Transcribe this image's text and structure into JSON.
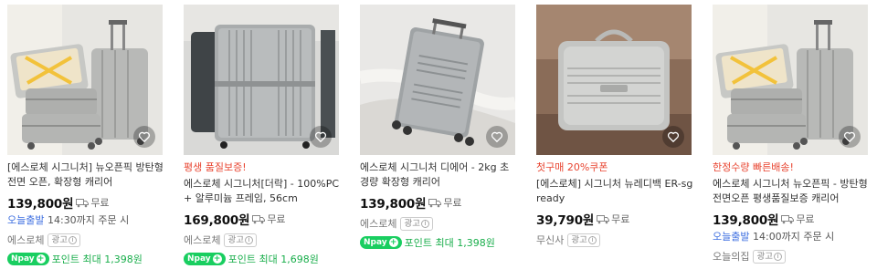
{
  "products": [
    {
      "promo": "",
      "title": "[에스로체 시그니처] 뉴오픈픽 방탄형 전면 오픈, 확장형 캐리어",
      "price": "139,800원",
      "shipping": "무료",
      "delivery_highlight": "오늘출발",
      "delivery_rest": "14:30까지 주문 시",
      "seller": "에스로체",
      "ad_label": "광고",
      "points": "포인트 최대 1,398원",
      "npay_label": "pay",
      "icons": [
        "heart-icon",
        "truck-icon",
        "info-icon"
      ]
    },
    {
      "promo": "평생 품질보증!",
      "title": "에스로체 시그니처[더락] - 100%PC + 알루미늄 프레임, 56cm",
      "price": "169,800원",
      "shipping": "무료",
      "seller": "에스로체",
      "ad_label": "광고",
      "points": "포인트 최대 1,698원",
      "npay_label": "pay"
    },
    {
      "promo": "",
      "title": "에스로체 시그니처 디에어 - 2kg 초경량 확장형 캐리어",
      "price": "139,800원",
      "shipping": "무료",
      "seller": "에스로체",
      "ad_label": "광고",
      "points": "포인트 최대 1,398원",
      "npay_label": "pay"
    },
    {
      "promo": "첫구매 20%쿠폰",
      "title": "[에스로체] 시그니처 뉴레디백 ER-sgready",
      "price": "39,790원",
      "shipping": "무료",
      "seller": "무신사",
      "ad_label": "광고"
    },
    {
      "promo": "한정수량 빠른배송!",
      "title": "에스로체 시그니처 뉴오픈픽 - 방탄형 전면오픈 평생품질보증 캐리어",
      "price": "139,800원",
      "shipping": "무료",
      "delivery_highlight": "오늘출발",
      "delivery_rest": "14:00까지 주문 시",
      "seller": "오늘의집",
      "ad_label": "광고"
    }
  ],
  "colors": {
    "promo": "#e8432f",
    "delivery": "#3c6ee0",
    "points": "#19ae4b",
    "npay": "#19ce60"
  }
}
